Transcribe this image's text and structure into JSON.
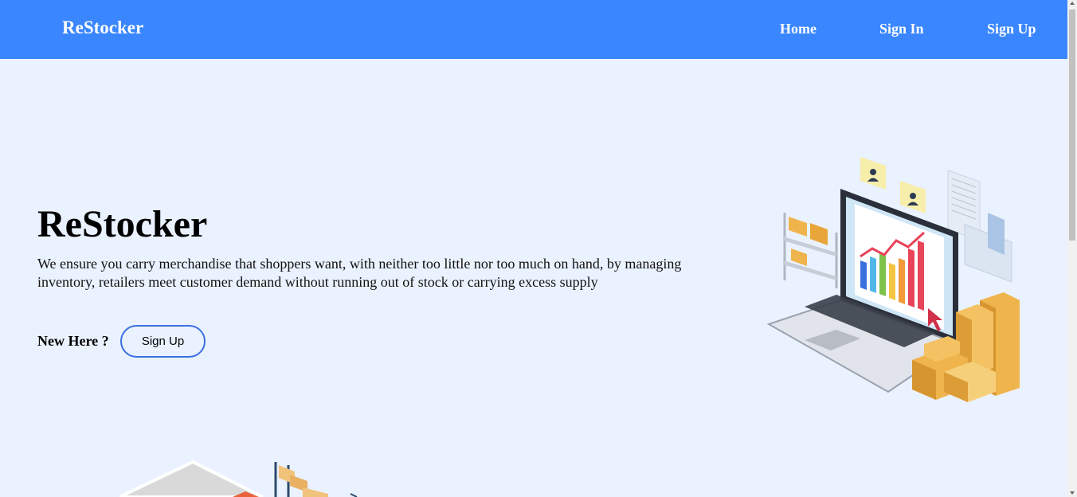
{
  "navbar": {
    "brand": "ReStocker",
    "links": [
      {
        "label": "Home"
      },
      {
        "label": "Sign In"
      },
      {
        "label": "Sign Up"
      }
    ]
  },
  "hero": {
    "title": "ReStocker",
    "description": "We ensure you carry merchandise that shoppers want, with neither too little nor too much on hand, by managing inventory, retailers meet customer demand without running out of stock or carrying excess supply",
    "new_here_label": "New Here ?",
    "cta_label": "Sign Up"
  },
  "illustrations": {
    "hero_icon": "laptop-inventory-illustration",
    "secondary_icon": "warehouse-illustration"
  },
  "colors": {
    "navbar_bg": "#3a86ff",
    "page_bg": "#eaf2ff",
    "button_border": "#3a6fe0"
  }
}
